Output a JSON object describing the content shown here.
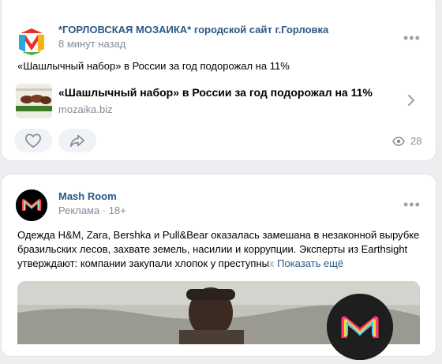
{
  "posts": [
    {
      "author": "*ГОРЛОВСКАЯ МОЗАИКА* городской сайт г.Горловка",
      "time": "8 минут назад",
      "text": "«Шашлычный набор» в России за год подорожал на 11%",
      "link": {
        "title": "«Шашлычный набор» в России за год подорожал на 11%",
        "domain": "mozaika.biz"
      },
      "views": "28",
      "icons": [
        "more-icon",
        "like-icon",
        "share-icon",
        "eye-icon",
        "chevron-right-icon"
      ]
    },
    {
      "author": "Mash Room",
      "meta_label": "Реклама",
      "meta_sep": "·",
      "age": "18+",
      "text_line1": "Одежда H&M, Zara, Bershka и Pull&Bear оказалась замешана в незаконной вырубке",
      "text_line2": "бразильских лесов, захвате земель, насилии и коррупции. Эксперты из Earthsight",
      "text_line3_visible": "утверждают: компании закупали хлопок у преступны",
      "text_line3_faded": "х",
      "show_more": "Показать ещё"
    }
  ],
  "colors": {
    "background": "#edeef0",
    "link": "#2a5885",
    "secondary": "#818c99",
    "pill": "#f0f2f5"
  }
}
